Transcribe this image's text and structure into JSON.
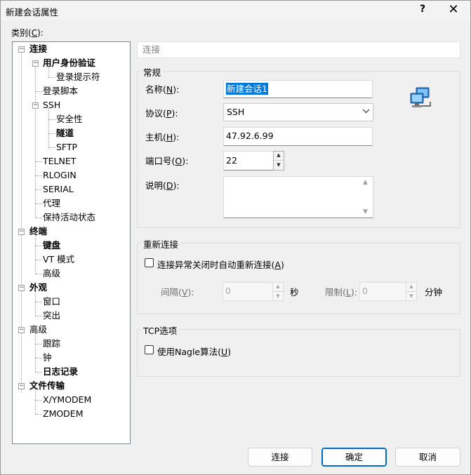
{
  "window": {
    "title": "新建会话属性",
    "help": "?",
    "close": "✕"
  },
  "category": {
    "label": "类别(",
    "key": "C",
    "suffix": "):"
  },
  "tree": {
    "connection": "连接",
    "user_auth": "用户身份验证",
    "login_prompt": "登录提示符",
    "login_script": "登录脚本",
    "ssh": "SSH",
    "security": "安全性",
    "tunnel": "隧道",
    "sftp": "SFTP",
    "telnet": "TELNET",
    "rlogin": "RLOGIN",
    "serial": "SERIAL",
    "proxy": "代理",
    "keepalive": "保持活动状态",
    "terminal": "终端",
    "keyboard": "键盘",
    "vt_mode": "VT 模式",
    "terminal_advanced": "高级",
    "appearance": "外观",
    "window": "窗口",
    "highlight": "突出",
    "advanced": "高级",
    "trace": "跟踪",
    "bell": "钟",
    "logging": "日志记录",
    "file_transfer": "文件传输",
    "xymodem": "X/YMODEM",
    "zmodem": "ZMODEM"
  },
  "section_header": "连接",
  "general": {
    "title": "常规",
    "name_label": "名称(",
    "name_key": "N",
    "name_suffix": "):",
    "name_value": "新建会话1",
    "protocol_label": "协议(",
    "protocol_key": "P",
    "protocol_suffix": "):",
    "protocol_value": "SSH",
    "host_label": "主机(",
    "host_key": "H",
    "host_suffix": "):",
    "host_value": "47.92.6.99",
    "port_label": "端口号(",
    "port_key": "O",
    "port_suffix": "):",
    "port_value": "22",
    "desc_label": "说明(",
    "desc_key": "D",
    "desc_suffix": "):",
    "desc_value": ""
  },
  "reconnect": {
    "title": "重新连接",
    "checkbox_label": "连接异常关闭时自动重新连接(",
    "checkbox_key": "A",
    "checkbox_suffix": ")",
    "interval_label": "间隔(",
    "interval_key": "V",
    "interval_suffix": "):",
    "interval_value": "0",
    "seconds": "秒",
    "limit_label": "限制(",
    "limit_key": "L",
    "limit_suffix": "):",
    "limit_value": "0",
    "minutes": "分钟"
  },
  "tcp": {
    "title": "TCP选项",
    "nagle_label": "使用Nagle算法(",
    "nagle_key": "U",
    "nagle_suffix": ")"
  },
  "buttons": {
    "connect": "连接",
    "ok": "确定",
    "cancel": "取消"
  },
  "colors": {
    "accent": "#0078d7",
    "default_button_border": "#0067c0"
  }
}
